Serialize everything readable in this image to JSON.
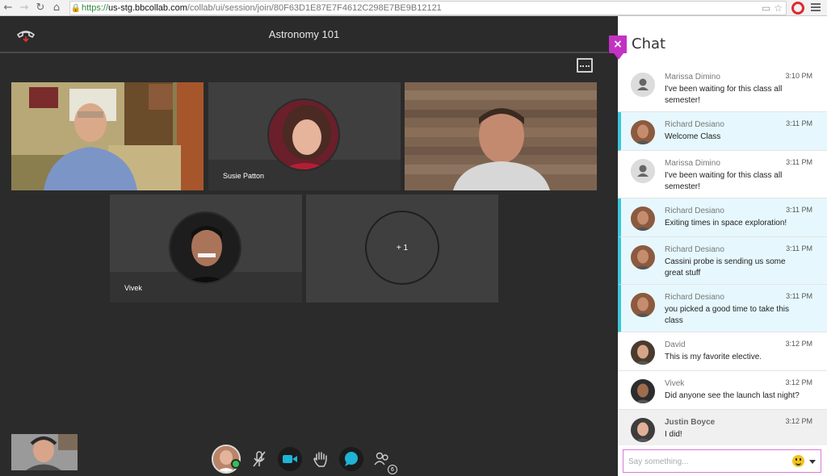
{
  "browser": {
    "url_scheme": "https://",
    "url_host": "us-stg.bbcollab.com",
    "url_path": "/collab/ui/session/join/80F63D1E87E7F4612C298E7BE9B12121"
  },
  "session": {
    "title": "Astronomy 101",
    "participants": [
      {
        "name": ""
      },
      {
        "name": "Susie Patton"
      },
      {
        "name": ""
      },
      {
        "name": "Vivek"
      }
    ],
    "more_count": "+ 1",
    "attendees_badge": "6"
  },
  "chat": {
    "title": "Chat",
    "close_label": "×",
    "input_placeholder": "Say something...",
    "messages": [
      {
        "author": "Marissa Dimino",
        "time": "3:10 PM",
        "text": "I've been waiting for this class all semester!",
        "style": "normal",
        "avatar": "default"
      },
      {
        "author": "Richard Desiano",
        "time": "3:11 PM",
        "text": "Welcome Class",
        "style": "highlight",
        "avatar": "photo"
      },
      {
        "author": "Marissa Dimino",
        "time": "3:11 PM",
        "text": "I've been waiting for this class all semester!",
        "style": "normal",
        "avatar": "default"
      },
      {
        "author": "Richard Desiano",
        "time": "3:11 PM",
        "text": "Exiting times in space exploration!",
        "style": "highlight",
        "avatar": "photo"
      },
      {
        "author": "Richard Desiano",
        "time": "3:11 PM",
        "text": "Cassini probe is sending us some great stuff",
        "style": "highlight",
        "avatar": "photo"
      },
      {
        "author": "Richard Desiano",
        "time": "3:11 PM",
        "text": "you picked a good time to take this class",
        "style": "highlight",
        "avatar": "photo"
      },
      {
        "author": "David",
        "time": "3:12 PM",
        "text": "This is my favorite elective.",
        "style": "normal",
        "avatar": "photo"
      },
      {
        "author": "Vivek",
        "time": "3:12 PM",
        "text": "Did anyone see the launch last night?",
        "style": "normal",
        "avatar": "photo"
      },
      {
        "author": "Justin Boyce",
        "time": "3:12 PM",
        "text": "I did!",
        "style": "selected",
        "avatar": "photo"
      }
    ]
  },
  "colors": {
    "accent": "#c233c4",
    "highlight_border": "#3ec8da",
    "highlight_bg": "#e6f8fd",
    "online": "#2fc25a",
    "control_blue": "#1fb3d6"
  }
}
